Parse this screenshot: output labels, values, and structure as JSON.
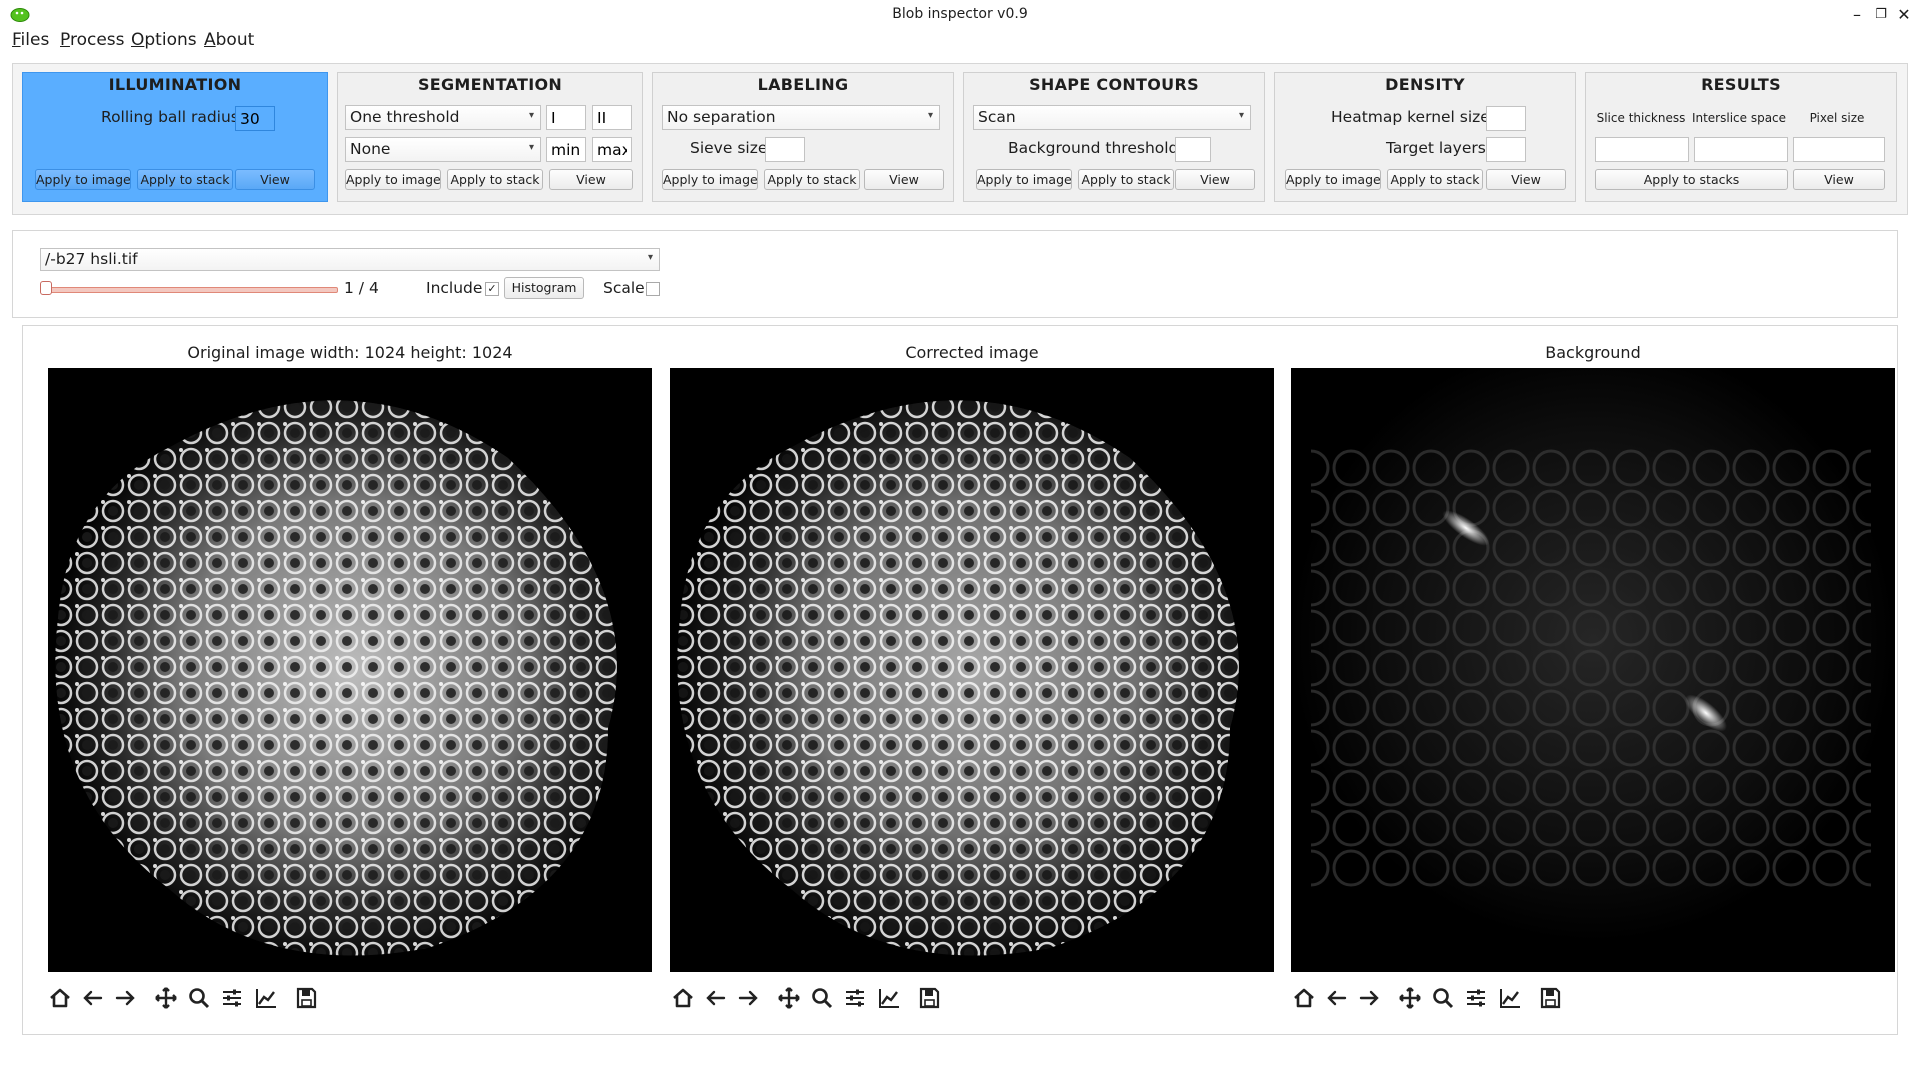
{
  "window": {
    "title": "Blob inspector v0.9",
    "controls": [
      "minimize",
      "restore",
      "close"
    ]
  },
  "menu": [
    {
      "label": "Files",
      "mnemonic": "F",
      "rest": "iles"
    },
    {
      "label": "Process",
      "mnemonic": "P",
      "rest": "rocess"
    },
    {
      "label": "Options",
      "mnemonic": "O",
      "rest": "ptions"
    },
    {
      "label": "About",
      "mnemonic": "A",
      "rest": "bout"
    }
  ],
  "groups": {
    "illumination": {
      "title": "ILLUMINATION",
      "rolling_ball_label": "Rolling ball radius",
      "rolling_ball_value": "30",
      "apply_image": "Apply to image",
      "apply_stack": "Apply to stack",
      "view": "View",
      "active_color": "#5aaeff"
    },
    "segmentation": {
      "title": "SEGMENTATION",
      "method": "One threshold",
      "field_i": "I",
      "field_ii": "II",
      "secondary": "None",
      "min_placeholder": "min",
      "max_placeholder": "max",
      "apply_image": "Apply to image",
      "apply_stack": "Apply to stack",
      "view": "View"
    },
    "labeling": {
      "title": "LABELING",
      "method": "No separation",
      "sieve_label": "Sieve size",
      "sieve_value": "",
      "apply_image": "Apply to image",
      "apply_stack": "Apply to stack",
      "view": "View"
    },
    "shape_contours": {
      "title": "SHAPE CONTOURS",
      "method": "Scan",
      "bg_threshold_label": "Background threshold",
      "bg_threshold_value": "",
      "apply_image": "Apply to image",
      "apply_stack": "Apply to stack",
      "view": "View"
    },
    "density": {
      "title": "DENSITY",
      "heatmap_label": "Heatmap kernel size",
      "heatmap_value": "",
      "target_label": "Target layers",
      "target_value": "",
      "apply_image": "Apply to image",
      "apply_stack": "Apply to stack",
      "view": "View"
    },
    "results": {
      "title": "RESULTS",
      "slice_label": "Slice thickness",
      "interslice_label": "Interslice space",
      "pixel_label": "Pixel size",
      "slice_value": "",
      "interslice_value": "",
      "pixel_value": "",
      "apply_stacks": "Apply to stacks",
      "view": "View"
    }
  },
  "file": {
    "current": "/-b27 hsli.tif",
    "slice_counter": "1 / 4",
    "slice_position": 0.0,
    "include_label": "Include",
    "include_checked": true,
    "histogram_button": "Histogram",
    "scale_label": "Scale",
    "scale_checked": false
  },
  "panels": [
    {
      "title": "Original image width: 1024 height: 1024",
      "kind": "original"
    },
    {
      "title": "Corrected image",
      "kind": "corrected"
    },
    {
      "title": "Background",
      "kind": "background"
    }
  ],
  "toolbar_icons": [
    "home-icon",
    "back-arrow-icon",
    "forward-arrow-icon",
    "pan-icon",
    "zoom-icon",
    "configure-subplots-icon",
    "edit-axis-icon",
    "save-icon"
  ]
}
